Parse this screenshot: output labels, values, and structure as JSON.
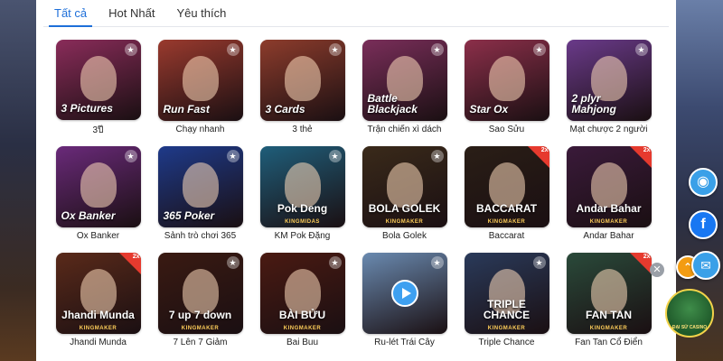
{
  "tabs": [
    {
      "label": "Tất cả",
      "active": true
    },
    {
      "label": "Hot Nhất",
      "active": false
    },
    {
      "label": "Yêu thích",
      "active": false
    }
  ],
  "games": [
    {
      "label": "3ปี",
      "art": "3 Pictures",
      "bg": "#8a2c5a"
    },
    {
      "label": "Chạy nhanh",
      "art": "Run Fast",
      "bg": "#9a3a2e"
    },
    {
      "label": "3 thẻ",
      "art": "3 Cards",
      "bg": "#8d3c2c"
    },
    {
      "label": "Trận chiến xì dách",
      "art": "Battle Blackjack",
      "bg": "#7a2e5a"
    },
    {
      "label": "Sao Sửu",
      "art": "Star Ox",
      "bg": "#8c2f4a"
    },
    {
      "label": "Mạt chược 2 người",
      "art": "2 plyr Mahjong",
      "bg": "#6a3a8a"
    },
    {
      "label": "Ox Banker",
      "art": "Ox Banker",
      "bg": "#6a2a7a"
    },
    {
      "label": "Sảnh trò chơi 365",
      "art": "365 Poker",
      "bg": "#1e3a8a"
    },
    {
      "label": "KM Pok Đặng",
      "art": "Pok Deng",
      "bg": "#1f5e7a",
      "brand": "KINGMIDAS"
    },
    {
      "label": "Bola Golek",
      "art": "BOLA GOLEK",
      "bg": "#3a2a1a",
      "brand": "KINGMAKER"
    },
    {
      "label": "Baccarat",
      "art": "BACCARAT",
      "bg": "#2a1e16",
      "brand": "KINGMAKER",
      "badge": "2x"
    },
    {
      "label": "Andar Bahar",
      "art": "Andar Bahar",
      "bg": "#3a1a3a",
      "brand": "KINGMAKER",
      "badge": "2x"
    },
    {
      "label": "Jhandi Munda",
      "art": "Jhandi Munda",
      "bg": "#5a2a1a",
      "brand": "KINGMAKER",
      "badge": "2x"
    },
    {
      "label": "7 Lên 7 Giảm",
      "art": "7 up 7 down",
      "bg": "#3a1a12",
      "brand": "KINGMAKER"
    },
    {
      "label": "Bai Buu",
      "art": "BÀI BỬU",
      "bg": "#4a1a12",
      "brand": "KINGMAKER"
    },
    {
      "label": "Ru-lét Trái Cây",
      "art": "",
      "bg": "#6a8ab0",
      "video": true
    },
    {
      "label": "Triple Chance",
      "art": "TRIPLE CHANCE",
      "bg": "#2a3a5a",
      "brand": "KINGMAKER"
    },
    {
      "label": "Fan Tan Cổ Điển",
      "art": "FAN TAN",
      "bg": "#2a4a3a",
      "brand": "KINGMAKER",
      "badge": "2x"
    }
  ],
  "floating": {
    "chat_icon": "chat-icon",
    "facebook_icon": "facebook-icon",
    "scroll_up_icon": "chevron-up-icon",
    "mail_icon": "mail-icon",
    "close_icon": "close-icon",
    "promo_text": "ĐẠI SỨ CASINO",
    "colors": {
      "accent": "#1e6fd9",
      "facebook": "#1877f2",
      "scroll": "#f39c12",
      "chat": "#3aa0e8"
    }
  }
}
